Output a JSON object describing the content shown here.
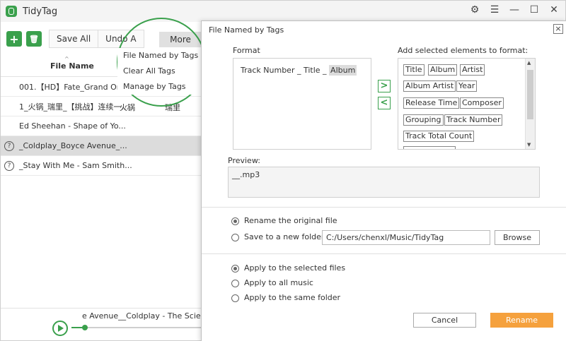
{
  "app": {
    "title": "TidyTag"
  },
  "toolbar": {
    "add_label": "+",
    "delete_label": "🗑",
    "save_all_label": "Save All",
    "undo_label": "Undo A",
    "more_label": "More"
  },
  "table": {
    "header_filename": "File Name",
    "sort_arrow": "^",
    "rows": [
      {
        "name": "001.【HD】Fate_Grand Ord...",
        "extra": "",
        "extra2": "",
        "warn": false,
        "selected": false
      },
      {
        "name": "1_火锅_瑞里_【挑战】连续一...",
        "extra": "火锅",
        "extra2": "瑞里",
        "warn": false,
        "selected": false
      },
      {
        "name": "Ed Sheehan - Shape of Yo...",
        "extra": "",
        "extra2": "",
        "warn": false,
        "selected": false
      },
      {
        "name": "_Coldplay_Boyce Avenue_...",
        "extra": "",
        "extra2": "",
        "warn": true,
        "selected": true
      },
      {
        "name": "_Stay With Me - Sam Smith...",
        "extra": "",
        "extra2": "",
        "warn": true,
        "selected": false
      }
    ],
    "warn_icon": "?"
  },
  "player": {
    "now_playing": "e Avenue__Coldplay - The Scientis",
    "progress": 0.1
  },
  "menu": {
    "items": [
      "File Named by Tags",
      "Clear All Tags",
      "Manage by Tags"
    ]
  },
  "dialog": {
    "title": "File Named by Tags",
    "close_label": "×",
    "format_label": "Format",
    "format_parts": {
      "track": "Track Number",
      "sep1": " _ ",
      "title": "Title",
      "sep2": " _ ",
      "album": "Album"
    },
    "elements_label": "Add selected elements to format:",
    "add_arrow": ">",
    "remove_arrow": "<",
    "elements": [
      "Title",
      "Album",
      "Artist",
      "Album Artist",
      "Year",
      "Release Time",
      "Composer",
      "Grouping",
      "Track Number",
      "Track Total Count",
      ""
    ],
    "preview_label": "Preview:",
    "preview_value": "__.mp3",
    "rename_options": [
      {
        "label": "Rename the original file",
        "checked": true
      },
      {
        "label": "Save to a new folder:",
        "checked": false
      }
    ],
    "folder_path": "C:/Users/chenxl/Music/TidyTag",
    "browse_label": "Browse",
    "apply_options": [
      {
        "label": "Apply to the selected files",
        "checked": true
      },
      {
        "label": "Apply to all music",
        "checked": false
      },
      {
        "label": "Apply to the same folder",
        "checked": false
      }
    ],
    "cancel_label": "Cancel",
    "rename_label": "Rename"
  },
  "icons": {
    "settings": "gear-icon",
    "menu": "hamburger-icon",
    "minimize": "minimize-icon",
    "maximize": "maximize-icon",
    "close": "close-icon"
  },
  "colors": {
    "accent_green": "#3aa04c",
    "rename_orange": "#f5a13d"
  }
}
